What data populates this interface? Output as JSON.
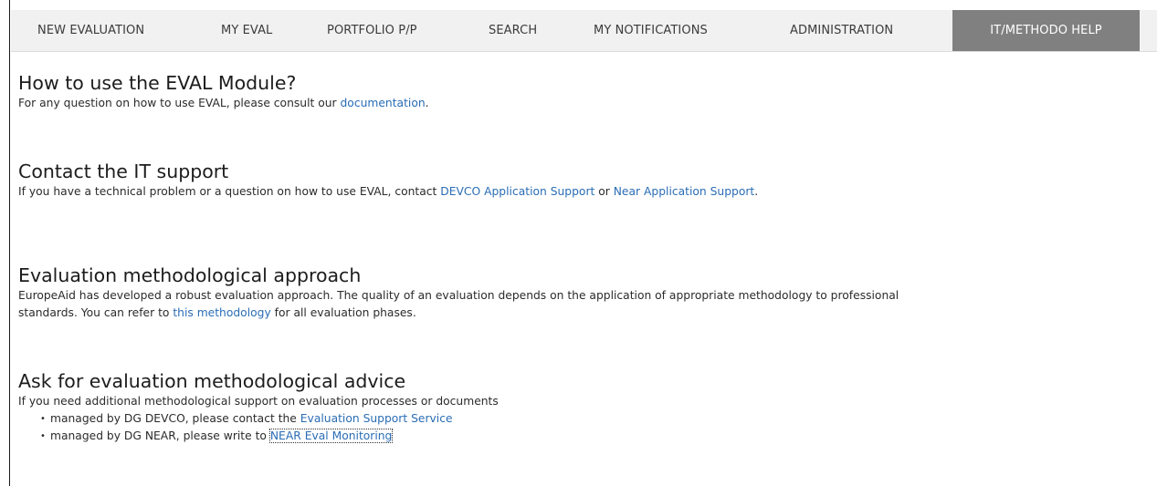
{
  "nav": {
    "items": [
      {
        "label": "NEW EVALUATION"
      },
      {
        "label": "MY EVAL"
      },
      {
        "label": "PORTFOLIO P/P"
      },
      {
        "label": "SEARCH"
      },
      {
        "label": "MY NOTIFICATIONS"
      },
      {
        "label": "ADMINISTRATION"
      },
      {
        "label": "IT/METHODO HELP",
        "active": true
      }
    ]
  },
  "sections": {
    "howto": {
      "title": "How to use the EVAL Module?",
      "text_before": "For any question on how to use EVAL, please consult our ",
      "link": "documentation",
      "text_after": "."
    },
    "contact": {
      "title": "Contact the IT support",
      "text_before": "If you have a technical problem or a question on how to use EVAL, contact ",
      "link1": "DEVCO Application Support",
      "text_mid": " or ",
      "link2": "Near Application Support",
      "text_after": "."
    },
    "methodology": {
      "title": "Evaluation methodological approach",
      "text_before": "EuropeAid has developed a robust evaluation approach. The quality of an evaluation depends on the application of appropriate methodology to professional standards. You can refer to ",
      "link": "this methodology",
      "text_after": " for all evaluation phases."
    },
    "advice": {
      "title": "Ask for evaluation methodological advice",
      "intro": "If you need additional methodological support on evaluation processes or documents",
      "bullet_glyph": "•",
      "items": [
        {
          "text": "managed by DG DEVCO, please contact the ",
          "link": "Evaluation Support Service"
        },
        {
          "text": "managed by DG NEAR, please write to ",
          "link": "NEAR Eval Monitoring"
        }
      ]
    }
  },
  "colors": {
    "link": "#2a6db5",
    "nav_bg": "#f1f1f1",
    "nav_active_bg": "#808080",
    "nav_text": "#3b3b3b"
  }
}
